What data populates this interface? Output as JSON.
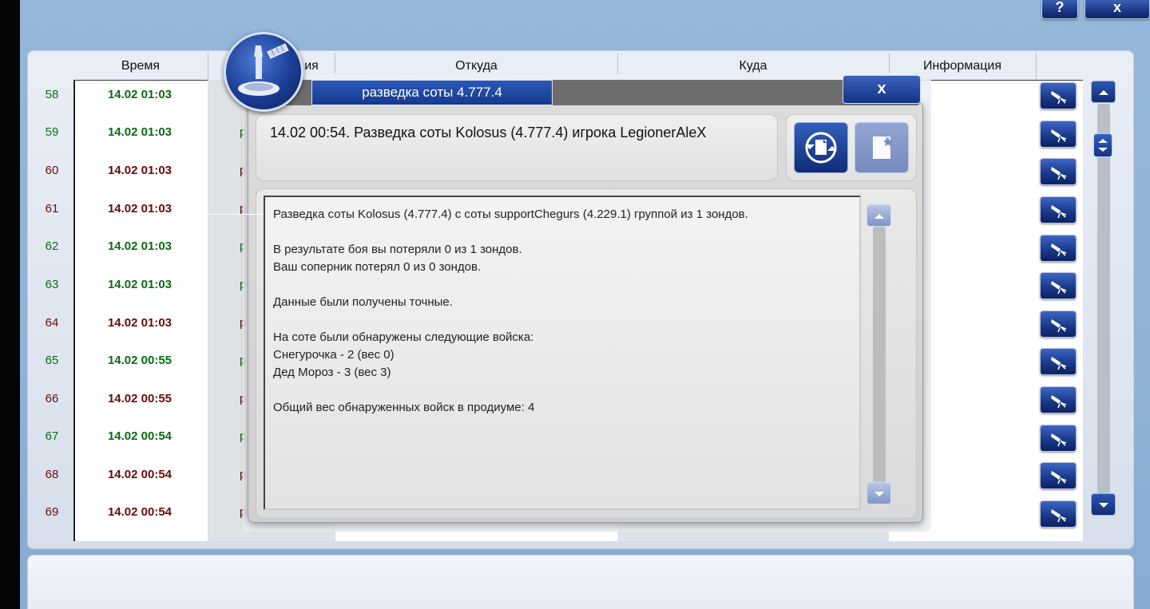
{
  "toolbar": {
    "help_label": "?",
    "close_label": "x"
  },
  "table": {
    "columns": [
      "Время",
      "ия",
      "Откуда",
      "Куда",
      "Информация"
    ],
    "rows": [
      {
        "num": "58",
        "time": "14.02 01:03",
        "frag": "р",
        "color": "green"
      },
      {
        "num": "59",
        "time": "14.02 01:03",
        "frag": "р",
        "color": "green"
      },
      {
        "num": "60",
        "time": "14.02 01:03",
        "frag": "р",
        "color": "red"
      },
      {
        "num": "61",
        "time": "14.02 01:03",
        "frag": "р",
        "color": "red"
      },
      {
        "num": "62",
        "time": "14.02 01:03",
        "frag": "р",
        "color": "green"
      },
      {
        "num": "63",
        "time": "14.02 01:03",
        "frag": "р",
        "color": "green"
      },
      {
        "num": "64",
        "time": "14.02 01:03",
        "frag": "р",
        "color": "red"
      },
      {
        "num": "65",
        "time": "14.02 00:55",
        "frag": "р",
        "color": "green"
      },
      {
        "num": "66",
        "time": "14.02 00:55",
        "frag": "р",
        "color": "red"
      },
      {
        "num": "67",
        "time": "14.02 00:54",
        "frag": "р",
        "color": "green"
      },
      {
        "num": "68",
        "time": "14.02 00:54",
        "frag": "р",
        "color": "red"
      },
      {
        "num": "69",
        "time": "14.02 00:54",
        "frag": "р",
        "color": "red"
      }
    ]
  },
  "dialog": {
    "title": "разведка соты 4.777.4",
    "close_label": "x",
    "header": "14.02 00:54. Разведка соты Kolosus (4.777.4) игрока LegionerAleX",
    "message_lines": [
      "Разведка соты Kolosus (4.777.4) с соты supportChegurs (4.229.1) группой из 1 зондов.",
      "",
      "В результате боя вы потеряли 0 из 1 зондов.",
      "Ваш соперник потерял 0 из 0 зондов.",
      "",
      "Данные были получены точные.",
      "",
      "На соте были обнаружены следующие войска:",
      "Снегурочка - 2 (вес 0)",
      "Дед Мороз - 3 (вес 3)",
      "",
      "Общий вес обнаруженных войск в продиуме: 4"
    ]
  },
  "icons": [
    "help-icon",
    "close-icon",
    "satellite-icon",
    "refresh-icon",
    "note-icon",
    "telescope-icon",
    "arrow-up-icon",
    "arrow-down-icon"
  ]
}
